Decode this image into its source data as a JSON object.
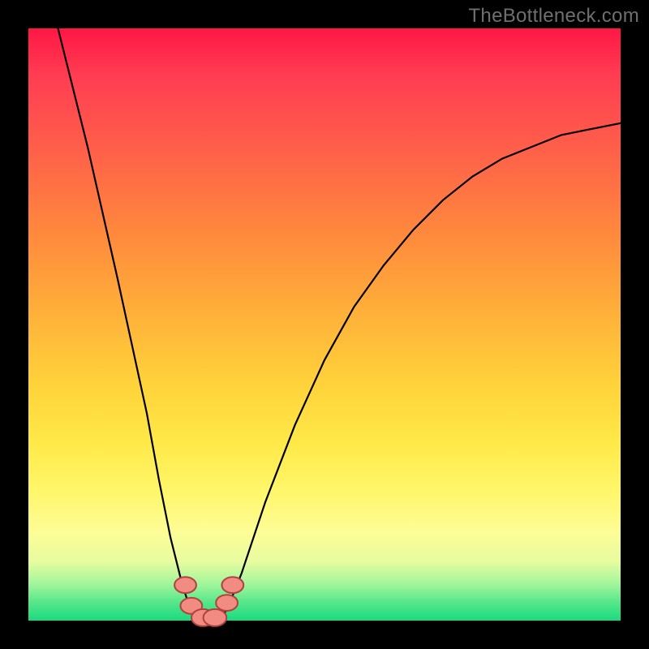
{
  "watermark": "TheBottleneck.com",
  "chart_data": {
    "type": "line",
    "title": "",
    "xlabel": "",
    "ylabel": "",
    "xlim": [
      0,
      100
    ],
    "ylim": [
      0,
      100
    ],
    "background_gradient_stops": [
      {
        "pct": 0,
        "color": "#ff1744"
      },
      {
        "pct": 35,
        "color": "#ff8a3c"
      },
      {
        "pct": 60,
        "color": "#ffd23a"
      },
      {
        "pct": 85,
        "color": "#fdfd96"
      },
      {
        "pct": 100,
        "color": "#19db7e"
      }
    ],
    "series": [
      {
        "name": "bottleneck-curve",
        "x": [
          5,
          10,
          15,
          20,
          22,
          24,
          26,
          27,
          28,
          29,
          30,
          31,
          32,
          33,
          34,
          36,
          40,
          45,
          50,
          55,
          60,
          65,
          70,
          75,
          80,
          85,
          90,
          95,
          100
        ],
        "y": [
          100,
          80,
          58,
          35,
          24,
          14,
          6,
          3,
          1,
          0,
          0,
          0,
          0,
          1,
          3,
          8,
          20,
          33,
          44,
          53,
          60,
          66,
          71,
          75,
          78,
          80,
          82,
          83,
          84
        ]
      }
    ],
    "markers": [
      {
        "name": "left-top-bean",
        "cx": 26.5,
        "cy": 6,
        "r": 1.6
      },
      {
        "name": "left-mid-bean",
        "cx": 27.5,
        "cy": 2.5,
        "r": 1.6
      },
      {
        "name": "bottom-bean-1",
        "cx": 29.5,
        "cy": 0.5,
        "r": 1.7
      },
      {
        "name": "bottom-bean-2",
        "cx": 31.5,
        "cy": 0.5,
        "r": 1.7
      },
      {
        "name": "right-mid-bean",
        "cx": 33.5,
        "cy": 3,
        "r": 1.6
      },
      {
        "name": "right-top-bean",
        "cx": 34.5,
        "cy": 6,
        "r": 1.6
      }
    ],
    "min_x": 30
  }
}
